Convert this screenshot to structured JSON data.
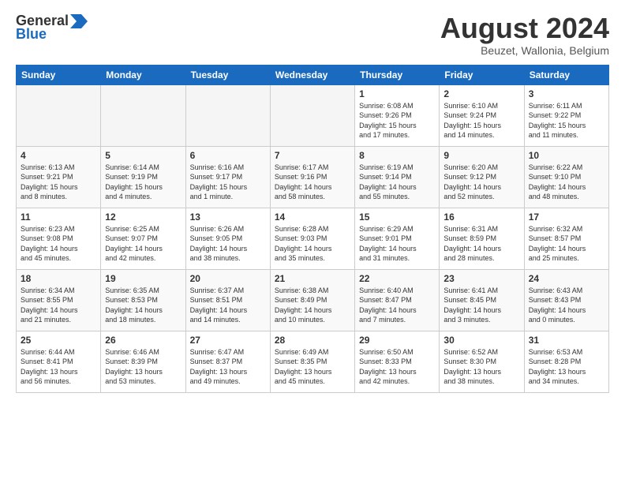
{
  "header": {
    "logo": {
      "line1": "General",
      "line2": "Blue"
    },
    "title": "August 2024",
    "location": "Beuzet, Wallonia, Belgium"
  },
  "days_of_week": [
    "Sunday",
    "Monday",
    "Tuesday",
    "Wednesday",
    "Thursday",
    "Friday",
    "Saturday"
  ],
  "weeks": [
    [
      {
        "day": "",
        "info": ""
      },
      {
        "day": "",
        "info": ""
      },
      {
        "day": "",
        "info": ""
      },
      {
        "day": "",
        "info": ""
      },
      {
        "day": "1",
        "info": "Sunrise: 6:08 AM\nSunset: 9:26 PM\nDaylight: 15 hours\nand 17 minutes."
      },
      {
        "day": "2",
        "info": "Sunrise: 6:10 AM\nSunset: 9:24 PM\nDaylight: 15 hours\nand 14 minutes."
      },
      {
        "day": "3",
        "info": "Sunrise: 6:11 AM\nSunset: 9:22 PM\nDaylight: 15 hours\nand 11 minutes."
      }
    ],
    [
      {
        "day": "4",
        "info": "Sunrise: 6:13 AM\nSunset: 9:21 PM\nDaylight: 15 hours\nand 8 minutes."
      },
      {
        "day": "5",
        "info": "Sunrise: 6:14 AM\nSunset: 9:19 PM\nDaylight: 15 hours\nand 4 minutes."
      },
      {
        "day": "6",
        "info": "Sunrise: 6:16 AM\nSunset: 9:17 PM\nDaylight: 15 hours\nand 1 minute."
      },
      {
        "day": "7",
        "info": "Sunrise: 6:17 AM\nSunset: 9:16 PM\nDaylight: 14 hours\nand 58 minutes."
      },
      {
        "day": "8",
        "info": "Sunrise: 6:19 AM\nSunset: 9:14 PM\nDaylight: 14 hours\nand 55 minutes."
      },
      {
        "day": "9",
        "info": "Sunrise: 6:20 AM\nSunset: 9:12 PM\nDaylight: 14 hours\nand 52 minutes."
      },
      {
        "day": "10",
        "info": "Sunrise: 6:22 AM\nSunset: 9:10 PM\nDaylight: 14 hours\nand 48 minutes."
      }
    ],
    [
      {
        "day": "11",
        "info": "Sunrise: 6:23 AM\nSunset: 9:08 PM\nDaylight: 14 hours\nand 45 minutes."
      },
      {
        "day": "12",
        "info": "Sunrise: 6:25 AM\nSunset: 9:07 PM\nDaylight: 14 hours\nand 42 minutes."
      },
      {
        "day": "13",
        "info": "Sunrise: 6:26 AM\nSunset: 9:05 PM\nDaylight: 14 hours\nand 38 minutes."
      },
      {
        "day": "14",
        "info": "Sunrise: 6:28 AM\nSunset: 9:03 PM\nDaylight: 14 hours\nand 35 minutes."
      },
      {
        "day": "15",
        "info": "Sunrise: 6:29 AM\nSunset: 9:01 PM\nDaylight: 14 hours\nand 31 minutes."
      },
      {
        "day": "16",
        "info": "Sunrise: 6:31 AM\nSunset: 8:59 PM\nDaylight: 14 hours\nand 28 minutes."
      },
      {
        "day": "17",
        "info": "Sunrise: 6:32 AM\nSunset: 8:57 PM\nDaylight: 14 hours\nand 25 minutes."
      }
    ],
    [
      {
        "day": "18",
        "info": "Sunrise: 6:34 AM\nSunset: 8:55 PM\nDaylight: 14 hours\nand 21 minutes."
      },
      {
        "day": "19",
        "info": "Sunrise: 6:35 AM\nSunset: 8:53 PM\nDaylight: 14 hours\nand 18 minutes."
      },
      {
        "day": "20",
        "info": "Sunrise: 6:37 AM\nSunset: 8:51 PM\nDaylight: 14 hours\nand 14 minutes."
      },
      {
        "day": "21",
        "info": "Sunrise: 6:38 AM\nSunset: 8:49 PM\nDaylight: 14 hours\nand 10 minutes."
      },
      {
        "day": "22",
        "info": "Sunrise: 6:40 AM\nSunset: 8:47 PM\nDaylight: 14 hours\nand 7 minutes."
      },
      {
        "day": "23",
        "info": "Sunrise: 6:41 AM\nSunset: 8:45 PM\nDaylight: 14 hours\nand 3 minutes."
      },
      {
        "day": "24",
        "info": "Sunrise: 6:43 AM\nSunset: 8:43 PM\nDaylight: 14 hours\nand 0 minutes."
      }
    ],
    [
      {
        "day": "25",
        "info": "Sunrise: 6:44 AM\nSunset: 8:41 PM\nDaylight: 13 hours\nand 56 minutes."
      },
      {
        "day": "26",
        "info": "Sunrise: 6:46 AM\nSunset: 8:39 PM\nDaylight: 13 hours\nand 53 minutes."
      },
      {
        "day": "27",
        "info": "Sunrise: 6:47 AM\nSunset: 8:37 PM\nDaylight: 13 hours\nand 49 minutes."
      },
      {
        "day": "28",
        "info": "Sunrise: 6:49 AM\nSunset: 8:35 PM\nDaylight: 13 hours\nand 45 minutes."
      },
      {
        "day": "29",
        "info": "Sunrise: 6:50 AM\nSunset: 8:33 PM\nDaylight: 13 hours\nand 42 minutes."
      },
      {
        "day": "30",
        "info": "Sunrise: 6:52 AM\nSunset: 8:30 PM\nDaylight: 13 hours\nand 38 minutes."
      },
      {
        "day": "31",
        "info": "Sunrise: 6:53 AM\nSunset: 8:28 PM\nDaylight: 13 hours\nand 34 minutes."
      }
    ]
  ]
}
